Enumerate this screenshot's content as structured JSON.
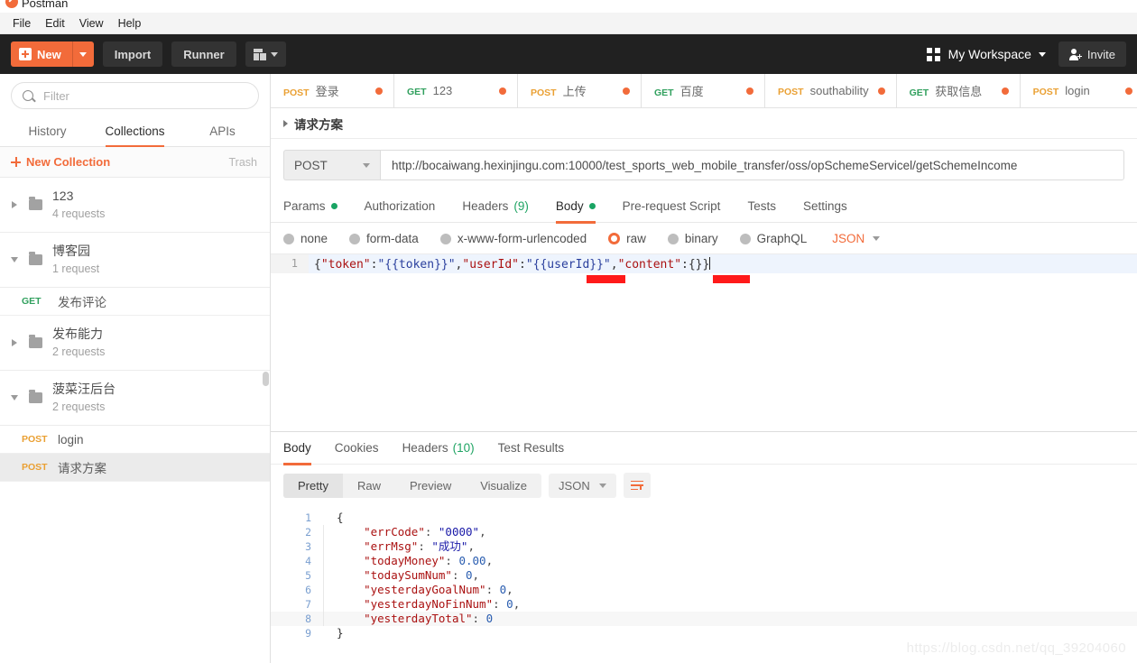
{
  "window": {
    "app_title": "Postman",
    "logo_icon": "postman-logo-icon"
  },
  "menubar": {
    "items": [
      {
        "label": "File"
      },
      {
        "label": "Edit"
      },
      {
        "label": "View"
      },
      {
        "label": "Help"
      }
    ]
  },
  "toolbar": {
    "new_label": "New",
    "import_label": "Import",
    "runner_label": "Runner",
    "new_window_icon": "new-window-icon",
    "workspace_label": "My Workspace",
    "workspace_icon": "grid-icon",
    "invite_label": "Invite",
    "invite_icon": "person-add-icon"
  },
  "sidebar": {
    "filter_placeholder": "Filter",
    "filter_value": "",
    "search_icon": "search-icon",
    "tabs": [
      {
        "label": "History",
        "active": false
      },
      {
        "label": "Collections",
        "active": true
      },
      {
        "label": "APIs",
        "active": false
      }
    ],
    "new_collection_label": "New Collection",
    "trash_label": "Trash",
    "items": [
      {
        "type": "collection",
        "name": "123",
        "requests": "4 requests",
        "expanded": false
      },
      {
        "type": "collection",
        "name": "博客园",
        "requests": "1 request",
        "expanded": true
      },
      {
        "type": "request",
        "method": "GET",
        "name": "发布评论",
        "selected": false
      },
      {
        "type": "collection",
        "name": "发布能力",
        "requests": "2 requests",
        "expanded": false
      },
      {
        "type": "collection",
        "name": "菠菜汪后台",
        "requests": "2 requests",
        "expanded": true
      },
      {
        "type": "request",
        "method": "POST",
        "name": "login",
        "selected": false
      },
      {
        "type": "request",
        "method": "POST",
        "name": "请求方案",
        "selected": true
      }
    ]
  },
  "request_tabs": [
    {
      "method": "POST",
      "name": "登录",
      "unsaved": true
    },
    {
      "method": "GET",
      "name": "123",
      "unsaved": true
    },
    {
      "method": "POST",
      "name": "上传",
      "unsaved": true
    },
    {
      "method": "GET",
      "name": "百度",
      "unsaved": true
    },
    {
      "method": "POST",
      "name": "southability",
      "unsaved": true
    },
    {
      "method": "GET",
      "name": "获取信息",
      "unsaved": true
    },
    {
      "method": "POST",
      "name": "login",
      "unsaved": true
    }
  ],
  "breadcrumb": {
    "label": "请求方案"
  },
  "url_bar": {
    "method": "POST",
    "url": "http://bocaiwang.hexinjingu.com:10000/test_sports_web_mobile_transfer/oss/opSchemeServicel/getSchemeIncome"
  },
  "request_sections": [
    {
      "label": "Params",
      "dot": true,
      "active": false
    },
    {
      "label": "Authorization",
      "dot": false,
      "active": false
    },
    {
      "label": "Headers",
      "count": "(9)",
      "dot": false,
      "active": false
    },
    {
      "label": "Body",
      "dot": true,
      "active": true
    },
    {
      "label": "Pre-request Script",
      "dot": false,
      "active": false
    },
    {
      "label": "Tests",
      "dot": false,
      "active": false
    },
    {
      "label": "Settings",
      "dot": false,
      "active": false
    }
  ],
  "body_modes": [
    {
      "label": "none",
      "selected": false
    },
    {
      "label": "form-data",
      "selected": false
    },
    {
      "label": "x-www-form-urlencoded",
      "selected": false
    },
    {
      "label": "raw",
      "selected": true
    },
    {
      "label": "binary",
      "selected": false
    },
    {
      "label": "GraphQL",
      "selected": false
    }
  ],
  "body_format": "JSON",
  "request_body": {
    "line_number": "1",
    "segments": [
      {
        "text": "{",
        "kind": "punct"
      },
      {
        "text": "\"token\"",
        "kind": "key"
      },
      {
        "text": ":",
        "kind": "punct"
      },
      {
        "text": "\"{{token}}\"",
        "kind": "str"
      },
      {
        "text": ",",
        "kind": "punct"
      },
      {
        "text": "\"userId\"",
        "kind": "key"
      },
      {
        "text": ":",
        "kind": "punct"
      },
      {
        "text": "\"{{userId}}\"",
        "kind": "str"
      },
      {
        "text": ",",
        "kind": "punct"
      },
      {
        "text": "\"content\"",
        "kind": "key"
      },
      {
        "text": ":",
        "kind": "punct"
      },
      {
        "text": "{}}",
        "kind": "punct"
      }
    ],
    "raw_text": "{\"token\":\"{{token}}\",\"userId\":\"{{userId}}\",\"content\":{}}",
    "redaction_color": "#ff1a1a"
  },
  "response": {
    "tabs": [
      {
        "label": "Body",
        "active": true
      },
      {
        "label": "Cookies",
        "active": false
      },
      {
        "label": "Headers",
        "count": "(10)",
        "active": false
      },
      {
        "label": "Test Results",
        "active": false
      }
    ],
    "view_modes": [
      {
        "label": "Pretty",
        "active": true
      },
      {
        "label": "Raw",
        "active": false
      },
      {
        "label": "Preview",
        "active": false
      },
      {
        "label": "Visualize",
        "active": false
      }
    ],
    "format": "JSON",
    "wrap_icon": "word-wrap-icon",
    "body_lines": [
      {
        "num": "1",
        "text": "{",
        "highlight": false,
        "bar": false
      },
      {
        "num": "2",
        "key": "\"errCode\"",
        "sep": ": ",
        "value": "\"0000\"",
        "value_kind": "string",
        "comma": ",",
        "highlight": false,
        "bar": true
      },
      {
        "num": "3",
        "key": "\"errMsg\"",
        "sep": ": ",
        "value": "\"成功\"",
        "value_kind": "string",
        "comma": ",",
        "highlight": false,
        "bar": true
      },
      {
        "num": "4",
        "key": "\"todayMoney\"",
        "sep": ": ",
        "value": "0.00",
        "value_kind": "number",
        "comma": ",",
        "highlight": false,
        "bar": true
      },
      {
        "num": "5",
        "key": "\"todaySumNum\"",
        "sep": ": ",
        "value": "0",
        "value_kind": "number",
        "comma": ",",
        "highlight": false,
        "bar": true
      },
      {
        "num": "6",
        "key": "\"yesterdayGoalNum\"",
        "sep": ": ",
        "value": "0",
        "value_kind": "number",
        "comma": ",",
        "highlight": false,
        "bar": true
      },
      {
        "num": "7",
        "key": "\"yesterdayNoFinNum\"",
        "sep": ": ",
        "value": "0",
        "value_kind": "number",
        "comma": ",",
        "highlight": false,
        "bar": true
      },
      {
        "num": "8",
        "key": "\"yesterdayTotal\"",
        "sep": ": ",
        "value": "0",
        "value_kind": "number",
        "comma": "",
        "highlight": true,
        "bar": true
      },
      {
        "num": "9",
        "text": "}",
        "highlight": false,
        "bar": false
      }
    ]
  },
  "watermark": "https://blog.csdn.net/qq_39204060",
  "colors": {
    "accent": "#f26b3a",
    "toolbar_bg": "#212121",
    "get_green": "#31a05e",
    "post_orange": "#eaa033",
    "ok_green": "#19a463"
  }
}
